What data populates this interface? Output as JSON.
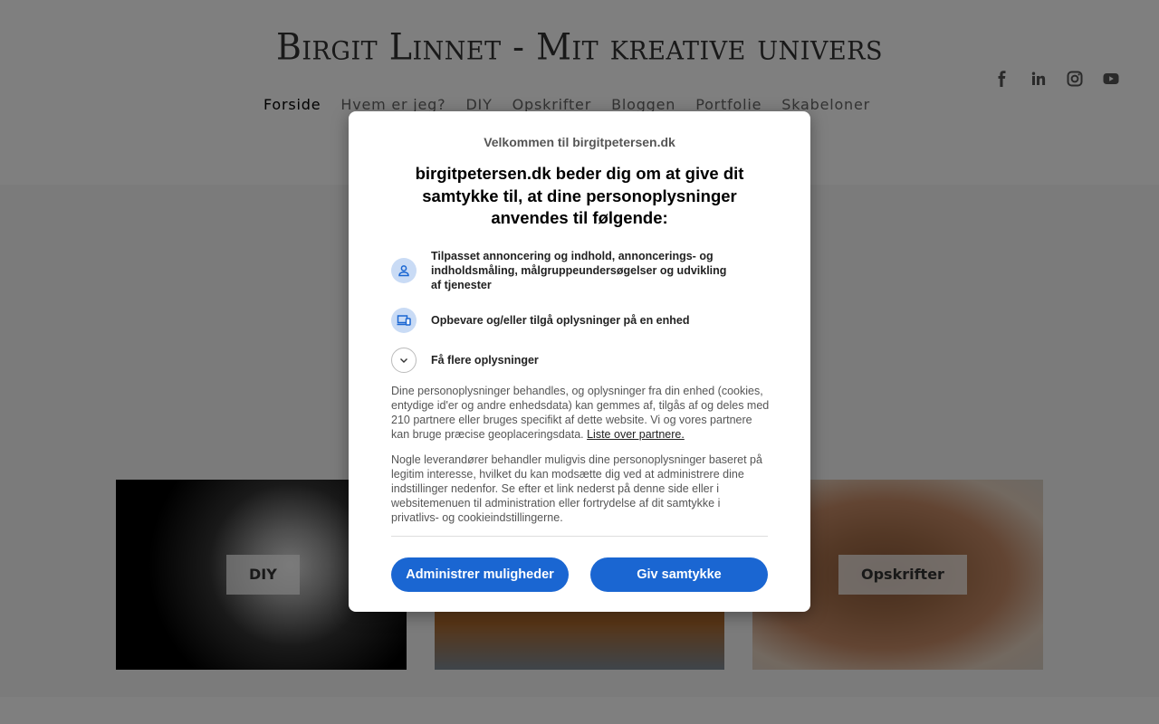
{
  "site": {
    "title": "Birgit Linnet - Mit kreative univers",
    "nav": [
      "Forside",
      "Hvem er jeg?",
      "DIY",
      "Opskrifter",
      "Bloggen",
      "Portfolie",
      "Skabeloner"
    ],
    "nav_active": "Forside",
    "social_icons": [
      "facebook-icon",
      "linkedin-icon",
      "instagram-icon",
      "youtube-icon"
    ]
  },
  "cards": [
    {
      "label": "DIY"
    },
    {
      "label": ""
    },
    {
      "label": "Opskrifter"
    }
  ],
  "consent": {
    "welcome": "Velkommen til birgitpetersen.dk",
    "heading": "birgitpetersen.dk beder dig om at give dit samtykke til, at dine personoplysninger anvendes til følgende:",
    "purposes": [
      {
        "icon": "person-icon",
        "text": "Tilpasset annoncering og indhold, annoncerings- og indholdsmåling, målgruppeundersøgelser og udvikling af tjenester"
      },
      {
        "icon": "devices-icon",
        "text": "Opbevare og/eller tilgå oplysninger på en enhed"
      },
      {
        "icon": "chevron-down-icon",
        "text": "Få flere oplysninger"
      }
    ],
    "body1": "Dine personoplysninger behandles, og oplysninger fra din enhed (cookies, entydige id'er og andre enhedsdata) kan gemmes af, tilgås af og deles med 210 partnere eller bruges specifikt af dette website. Vi og vores partnere kan bruge præcise geoplaceringsdata.",
    "partners_link": "Liste over partnere.",
    "body2": "Nogle leverandører behandler muligvis dine personoplysninger baseret på legitim interesse, hvilket du kan modsætte dig ved at administrere dine indstillinger nedenfor. Se efter et link nederst på denne side eller i websitemenuen til administration eller fortrydelse af dit samtykke i privatlivs- og cookieindstillingerne.",
    "manage_button": "Administrer muligheder",
    "consent_button": "Giv samtykke"
  },
  "colors": {
    "accent": "#1a66d2",
    "icon_bg": "#c9dbf5",
    "overlay": "rgba(0,0,0,0.5)"
  }
}
